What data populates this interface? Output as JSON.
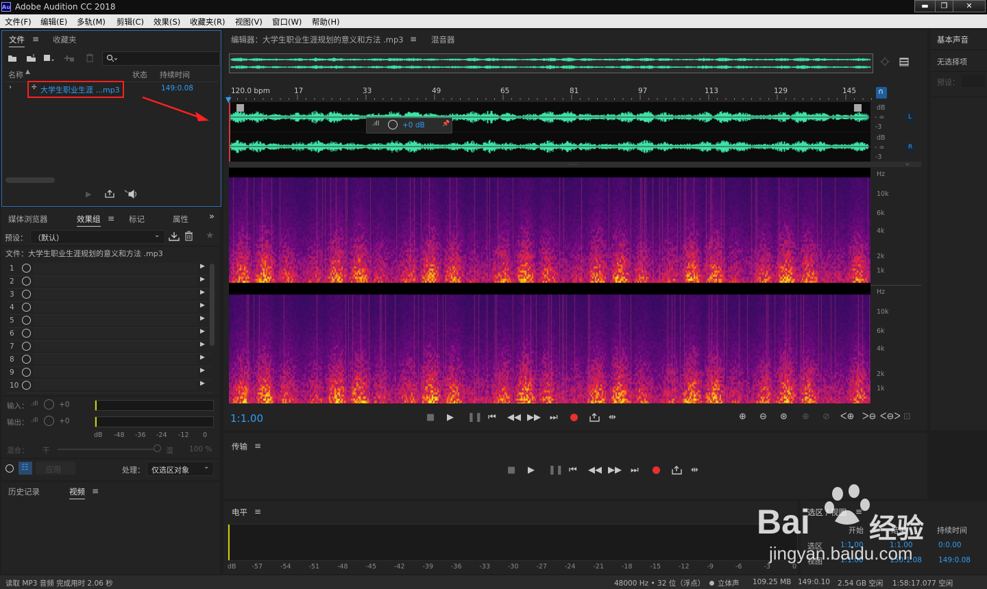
{
  "titlebar": {
    "logo": "Au",
    "title": "Adobe Audition CC 2018",
    "min": "▬",
    "max": "❐",
    "close": "✕"
  },
  "menu": [
    "文件(F)",
    "编辑(E)",
    "多轨(M)",
    "剪辑(C)",
    "效果(S)",
    "收藏夹(R)",
    "视图(V)",
    "窗口(W)",
    "帮助(H)"
  ],
  "files_panel": {
    "tabs": [
      "文件",
      "收藏夹"
    ],
    "cols": {
      "name": "名称",
      "status": "状态",
      "duration": "持续时间"
    },
    "file": {
      "name": "大学生职业生涯 ...mp3",
      "duration": "149:0.08"
    }
  },
  "effects_panel": {
    "tabs": [
      "媒体浏览器",
      "效果组",
      "标记",
      "属性"
    ],
    "preset_label": "预设：",
    "preset_value": "（默认）",
    "file_label": "文件：大学生职业生涯规划的意义和方法 .mp3",
    "rows": [
      "1",
      "2",
      "3",
      "4",
      "5",
      "6",
      "7",
      "8",
      "9",
      "10"
    ],
    "input_label": "输入：",
    "output_label": "输出：",
    "zero": "+0",
    "scale": [
      "dB",
      "-48",
      "-36",
      "-24",
      "-12",
      "0"
    ],
    "mix_label": "混合：",
    "mix_dry": "干",
    "mix_wet": "湿",
    "mix_pct": "100 %",
    "apply": "应用",
    "process_label": "处理：",
    "process_value": "仅选区对象"
  },
  "history_panel": {
    "tabs": [
      "历史记录",
      "视频"
    ]
  },
  "editor": {
    "tab": "编辑器：大学生职业生涯规划的意义和方法 .mp3",
    "mixer": "混音器",
    "bpm": "120.0 bpm",
    "ruler": [
      "17",
      "33",
      "49",
      "65",
      "81",
      "97",
      "113",
      "129",
      "145"
    ],
    "db": "dB",
    "inf": "- ∞",
    "m3": "-3",
    "gain": "+0 dB",
    "ch_left": "L",
    "ch_right": "R",
    "hz": "Hz",
    "freq": [
      "10k",
      "6k",
      "4k",
      "2k",
      "1k"
    ],
    "timecode": "1:1.00"
  },
  "transport": {
    "title": "传输"
  },
  "levels": {
    "title": "电平",
    "scale": [
      "dB",
      "-57",
      "-54",
      "-51",
      "-48",
      "-45",
      "-42",
      "-39",
      "-36",
      "-33",
      "-30",
      "-27",
      "-24",
      "-21",
      "-18",
      "-15",
      "-12",
      "-9",
      "-6",
      "-3",
      "0"
    ]
  },
  "essential": {
    "title": "基本声音",
    "no_selection": "无选择项",
    "preset": "预设："
  },
  "selection": {
    "title": "选区 / 视图",
    "col_start": "开始",
    "col_end": "结束",
    "col_dur": "持续时间",
    "sel_label": "选区",
    "view_label": "视图",
    "sel_start": "1:1.00",
    "sel_end": "1:1.00",
    "sel_dur": "0:0.00",
    "view_start": "1:1.00",
    "view_end": "150:1.08",
    "view_dur": "149:0.08"
  },
  "status": {
    "left": "读取 MP3 音频 完成用时 2.06 秒",
    "rate": "48000 Hz • 32 位（浮点）",
    "stereo": "立体声",
    "size": "109.25 MB",
    "dur": "149:0.10",
    "free": "2.54 GB 空闲",
    "free_time": "1:58:17.077 空闲"
  },
  "watermark": {
    "brand": "Bai",
    "jy": "经验",
    "url": "jingyan.baidu.com"
  },
  "colors": {
    "accent": "#2f9df5",
    "waveform": "#3ee3a6",
    "highlight": "#ff2020",
    "record": "#e83030"
  }
}
